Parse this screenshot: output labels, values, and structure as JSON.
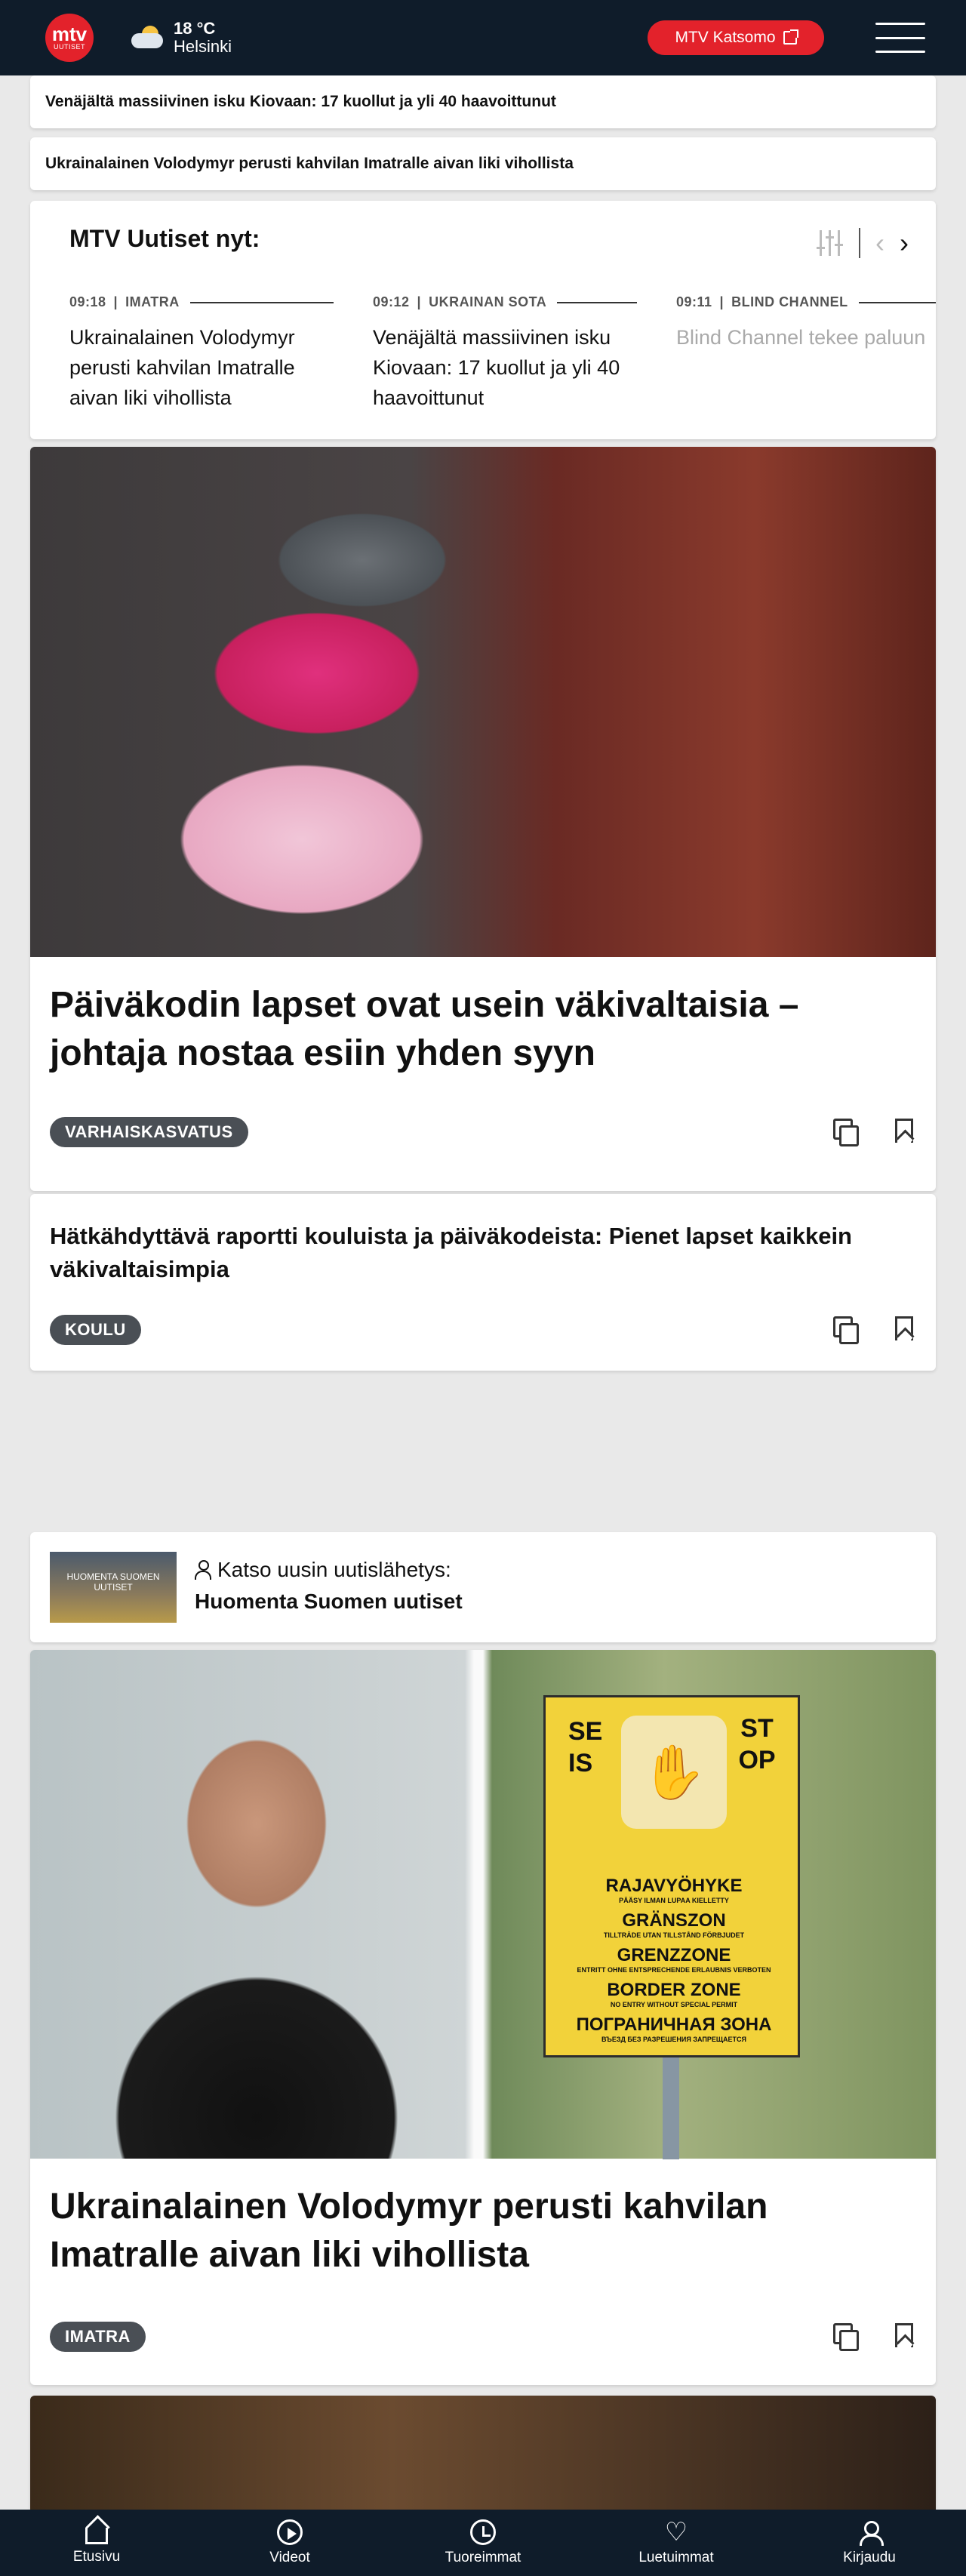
{
  "header": {
    "logo_top": "mtv",
    "logo_bottom": "UUTISET",
    "weather": {
      "temperature": "18 °C",
      "city": "Helsinki",
      "icon": "partly-cloudy-icon"
    },
    "katsomo_label": "MTV Katsomo",
    "menu_icon": "hamburger-menu-icon"
  },
  "breaking": [
    {
      "text": "Venäjältä massiivinen isku Kiovaan: 17 kuollut ja yli 40 haavoittunut"
    },
    {
      "text": "Ukrainalainen Volodymyr perusti kahvilan Imatralle aivan liki vihollista"
    }
  ],
  "feed": {
    "title": "MTV Uutiset nyt:",
    "items": [
      {
        "time": "09:18",
        "category": "IMATRA",
        "headline": "Ukrainalainen Volodymyr perusti kahvilan Imatralle aivan liki vihollista"
      },
      {
        "time": "09:12",
        "category": "UKRAINAN SOTA",
        "headline": "Venäjältä massiivinen isku Kiovaan: 17 kuollut ja yli 40 haavoittunut"
      },
      {
        "time": "09:11",
        "category": "BLIND CHANNEL",
        "headline": "Blind Channel tekee paluun"
      }
    ]
  },
  "articles": [
    {
      "headline": "Päiväkodin lapset ovat usein väkivaltaisia – johtaja nostaa esiin yhden syyn",
      "tag": "VARHAISKASVATUS"
    },
    {
      "headline": "Hätkähdyttävä raportti kouluista ja päiväkodeista: Pienet lapset kaikkein väkivaltaisimpia",
      "tag": "KOULU"
    },
    {
      "headline": "Ukrainalainen Volodymyr perusti kahvilan Imatralle aivan liki vihollista",
      "tag": "IMATRA"
    }
  ],
  "live": {
    "label": "Katso uusin uutislähetys:",
    "show": "Huomenta Suomen uutiset",
    "thumb_text": "HUOMENTA SUOMEN UUTISET"
  },
  "sign": {
    "seis": "SEIS",
    "stop": "STOP",
    "l1": "RAJAVYÖHYKE",
    "l1s": "PÄÄSY ILMAN LUPAA KIELLETTY",
    "l2": "GRÄNSZON",
    "l2s": "TILLTRÄDE UTAN TILLSTÅND FÖRBJUDET",
    "l3": "GRENZZONE",
    "l3s": "ENTRITT OHNE ENTSPRECHENDE ERLAUBNIS VERBOTEN",
    "l4": "BORDER ZONE",
    "l4s": "NO ENTRY WITHOUT SPECIAL PERMIT",
    "l5": "ПОГРАНИЧНАЯ ЗОНА",
    "l5s": "ВЪЕЗД БЕЗ РАЗРЕШЕНИЯ ЗАПРЕЩАЕТСЯ"
  },
  "bottom_nav": [
    {
      "label": "Etusivu",
      "icon": "home-icon"
    },
    {
      "label": "Videot",
      "icon": "play-icon"
    },
    {
      "label": "Tuoreimmat",
      "icon": "clock-icon"
    },
    {
      "label": "Luetuimmat",
      "icon": "heart-icon"
    },
    {
      "label": "Kirjaudu",
      "icon": "user-icon"
    }
  ]
}
